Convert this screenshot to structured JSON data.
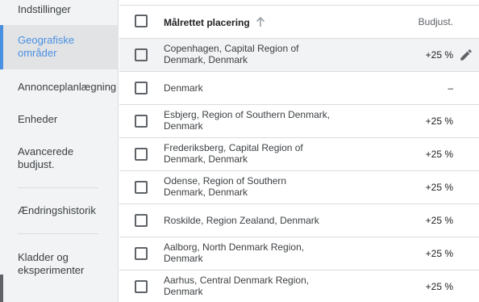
{
  "sidebar": {
    "items": [
      {
        "label": "Indstillinger"
      },
      {
        "label": "Geografiske områder"
      },
      {
        "label": "Annonceplanlægning"
      },
      {
        "label": "Enheder"
      },
      {
        "label": "Avancerede budjust."
      },
      {
        "label": "Ændringshistorik"
      },
      {
        "label": "Kladder og eksperimenter"
      }
    ],
    "active_index": 1
  },
  "table": {
    "columns": {
      "location": "Målrettet placering",
      "bid": "Budjust."
    },
    "sort": {
      "column": "location",
      "direction": "ascending"
    },
    "rows": [
      {
        "location": "Copenhagen, Capital Region of Denmark, Denmark",
        "bid": "+25 %"
      },
      {
        "location": "Denmark",
        "bid": "–"
      },
      {
        "location": "Esbjerg, Region of Southern Denmark, Denmark",
        "bid": "+25 %"
      },
      {
        "location": "Frederiksberg, Capital Region of Denmark, Denmark",
        "bid": "+25 %"
      },
      {
        "location": "Odense, Region of Southern Denmark, Denmark",
        "bid": "+25 %"
      },
      {
        "location": "Roskilde, Region Zealand, Denmark",
        "bid": "+25 %"
      },
      {
        "location": "Aalborg, North Denmark Region, Denmark",
        "bid": "+25 %"
      },
      {
        "location": "Aarhus, Central Denmark Region, Denmark",
        "bid": "+25 %"
      }
    ]
  },
  "colors": {
    "accent": "#4a90e2",
    "hover_row": "#f1f3f4",
    "sidebar_bg": "#f1f3f4"
  },
  "icons": {
    "sort": "arrow-up-icon",
    "edit": "pencil-icon"
  }
}
